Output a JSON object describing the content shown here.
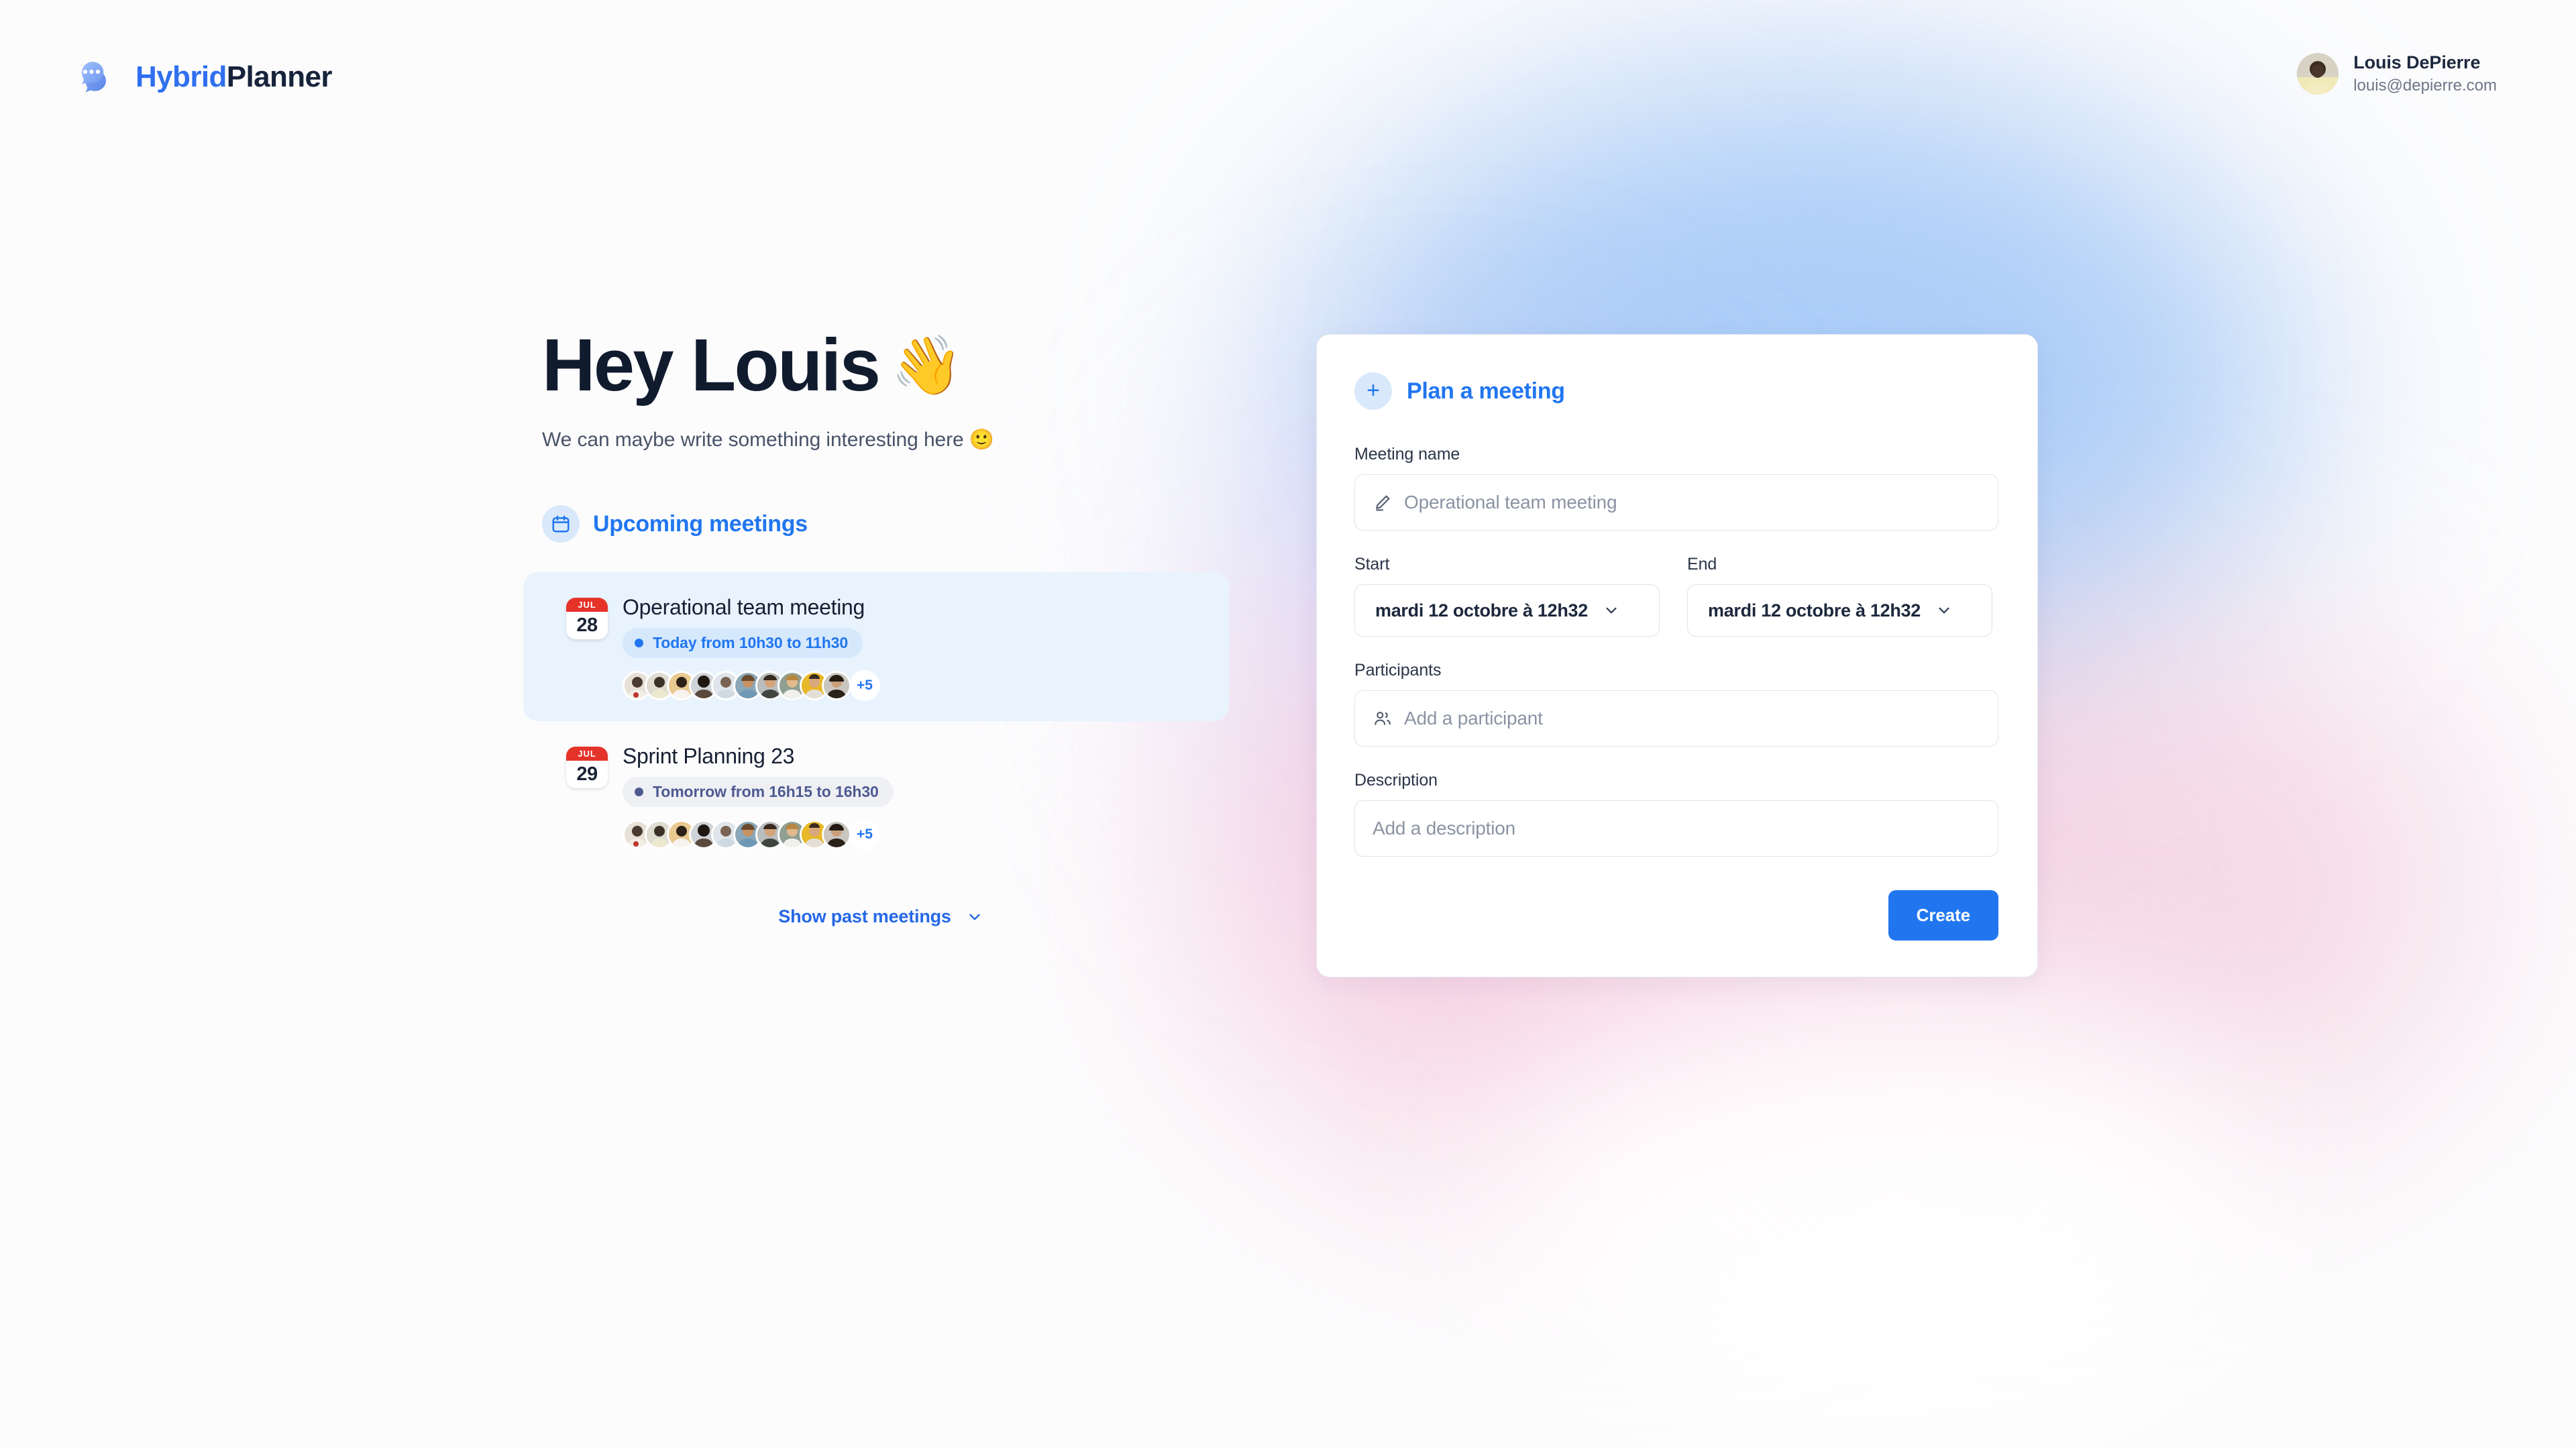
{
  "brand": {
    "name_part1": "Hybrid",
    "name_part2": "Planner",
    "logo_icon": "chat-bubble-icon",
    "accent_color": "#2176f0",
    "dark_color": "#17233b"
  },
  "user": {
    "name": "Louis DePierre",
    "email": "louis@depierre.com",
    "avatar_icon": "user-avatar"
  },
  "greeting": {
    "heading": "Hey Louis",
    "wave_emoji": "👋",
    "subtitle": "We can maybe write something interesting here 🙂"
  },
  "upcoming": {
    "icon": "calendar-icon",
    "title": "Upcoming meetings",
    "meetings": [
      {
        "month": "JUL",
        "day": "28",
        "title": "Operational team meeting",
        "when": "Today from 10h30 to 11h30",
        "when_style": "today",
        "avatar_count": 10,
        "extra_participants": "+5",
        "highlighted": true
      },
      {
        "month": "JUL",
        "day": "29",
        "title": "Sprint Planning 23",
        "when": "Tomorrow from 16h15 to 16h30",
        "when_style": "tomorrow",
        "avatar_count": 10,
        "extra_participants": "+5",
        "highlighted": false
      }
    ],
    "show_past_label": "Show past meetings",
    "show_past_icon": "chevron-down-icon"
  },
  "plan_card": {
    "plus_icon": "plus-icon",
    "title": "Plan a meeting",
    "meeting_name": {
      "label": "Meeting name",
      "icon": "pencil-icon",
      "placeholder": "Operational team meeting",
      "value": ""
    },
    "start": {
      "label": "Start",
      "value": "mardi 12 octobre à 12h32",
      "icon": "chevron-down-icon"
    },
    "end": {
      "label": "End",
      "value": "mardi 12 octobre à 12h32",
      "icon": "chevron-down-icon"
    },
    "participants": {
      "label": "Participants",
      "icon": "users-icon",
      "placeholder": "Add a participant",
      "value": ""
    },
    "description": {
      "label": "Description",
      "placeholder": "Add a description",
      "value": ""
    },
    "create_label": "Create"
  }
}
